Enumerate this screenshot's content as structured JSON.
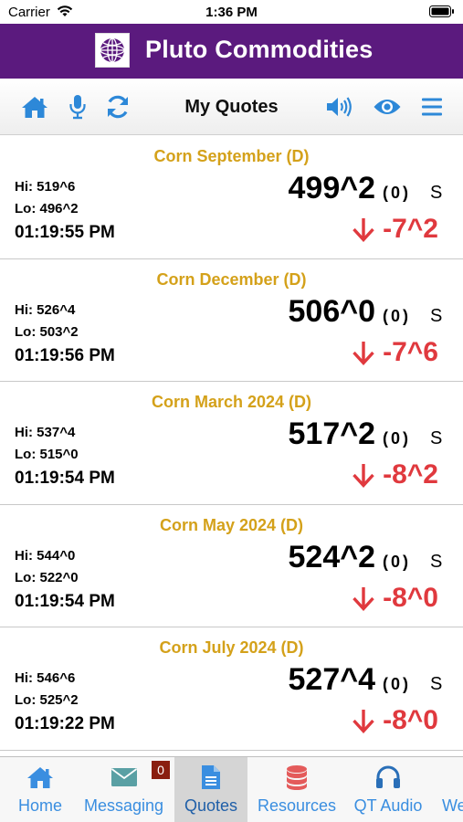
{
  "status": {
    "carrier": "Carrier",
    "time": "1:36 PM"
  },
  "header": {
    "title": "Pluto Commodities",
    "logo_icon": "globe-logo-icon"
  },
  "toolbar": {
    "title": "My Quotes",
    "icons": [
      "home-icon",
      "microphone-icon",
      "refresh-icon",
      "speaker-icon",
      "eye-icon",
      "menu-icon"
    ],
    "accent": "#2d88d8"
  },
  "quotes": [
    {
      "name": "Corn September (D)",
      "hi": "Hi: 519^6",
      "lo": "Lo: 496^2",
      "time": "01:19:55 PM",
      "last": "499^2",
      "volume": "(0)",
      "flag": "S",
      "change": "-7^2",
      "direction": "down"
    },
    {
      "name": "Corn December (D)",
      "hi": "Hi: 526^4",
      "lo": "Lo: 503^2",
      "time": "01:19:56 PM",
      "last": "506^0",
      "volume": "(0)",
      "flag": "S",
      "change": "-7^6",
      "direction": "down"
    },
    {
      "name": "Corn March 2024 (D)",
      "hi": "Hi: 537^4",
      "lo": "Lo: 515^0",
      "time": "01:19:54 PM",
      "last": "517^2",
      "volume": "(0)",
      "flag": "S",
      "change": "-8^2",
      "direction": "down"
    },
    {
      "name": "Corn May 2024 (D)",
      "hi": "Hi: 544^0",
      "lo": "Lo: 522^0",
      "time": "01:19:54 PM",
      "last": "524^2",
      "volume": "(0)",
      "flag": "S",
      "change": "-8^0",
      "direction": "down"
    },
    {
      "name": "Corn July 2024 (D)",
      "hi": "Hi: 546^6",
      "lo": "Lo: 525^2",
      "time": "01:19:22 PM",
      "last": "527^4",
      "volume": "(0)",
      "flag": "S",
      "change": "-8^0",
      "direction": "down"
    }
  ],
  "tabs": [
    {
      "label": "Home",
      "icon": "home-icon",
      "active": false
    },
    {
      "label": "Messaging",
      "icon": "envelope-icon",
      "badge": "0",
      "active": false
    },
    {
      "label": "Quotes",
      "icon": "document-icon",
      "active": true
    },
    {
      "label": "Resources",
      "icon": "database-icon",
      "active": false
    },
    {
      "label": "QT Audio",
      "icon": "headphones-icon",
      "active": false
    },
    {
      "label": "We",
      "icon": "",
      "active": false
    }
  ],
  "colors": {
    "header_bg": "#5b1a7e",
    "quote_name": "#d4a11a",
    "down_change": "#e0393e",
    "tab_text": "#3a8ee0"
  }
}
